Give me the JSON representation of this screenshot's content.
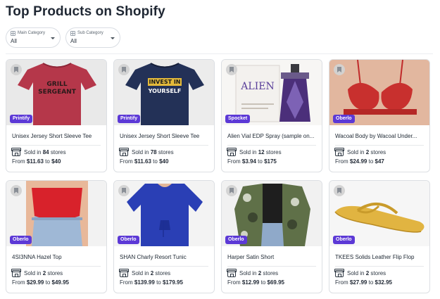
{
  "page": {
    "title": "Top Products on Shopify"
  },
  "filters": [
    {
      "label": "Main Category",
      "value": "All"
    },
    {
      "label": "Sub Category",
      "value": "All"
    }
  ],
  "products": [
    {
      "name": "Unisex Jersey Short Sleeve Tee",
      "source": "Printify",
      "stores_prefix": "Sold in",
      "stores": "84",
      "stores_suffix": "stores",
      "price_prefix": "From",
      "price_from": "$11.63",
      "price_sep": "to",
      "price_to": "$40",
      "image": "red-tshirt"
    },
    {
      "name": "Unisex Jersey Short Sleeve Tee",
      "source": "Printify",
      "stores_prefix": "Sold in",
      "stores": "78",
      "stores_suffix": "stores",
      "price_prefix": "From",
      "price_from": "$11.63",
      "price_sep": "to",
      "price_to": "$40",
      "image": "navy-tshirt"
    },
    {
      "name": "Alien Vial EDP Spray (sample on...",
      "source": "Spocket",
      "stores_prefix": "Sold in",
      "stores": "12",
      "stores_suffix": "stores",
      "price_prefix": "From",
      "price_from": "$3.94",
      "price_sep": "to",
      "price_to": "$175",
      "image": "perfume"
    },
    {
      "name": "Wacoal Body by Wacoal Under...",
      "source": "Oberlo",
      "stores_prefix": "Sold in",
      "stores": "2",
      "stores_suffix": "stores",
      "price_prefix": "From",
      "price_from": "$24.99",
      "price_sep": "to",
      "price_to": "$47",
      "image": "red-bra"
    },
    {
      "name": "4SI3NNA Hazel Top",
      "source": "Oberlo",
      "stores_prefix": "Sold in",
      "stores": "2",
      "stores_suffix": "stores",
      "price_prefix": "From",
      "price_from": "$29.99",
      "price_sep": "to",
      "price_to": "$49.95",
      "image": "red-top"
    },
    {
      "name": "SHAN Charly Resort Tunic",
      "source": "Oberlo",
      "stores_prefix": "Sold in",
      "stores": "2",
      "stores_suffix": "stores",
      "price_prefix": "From",
      "price_from": "$139.99",
      "price_sep": "to",
      "price_to": "$179.95",
      "image": "blue-tunic"
    },
    {
      "name": "Harper Satin Short",
      "source": "Oberlo",
      "stores_prefix": "Sold in",
      "stores": "2",
      "stores_suffix": "stores",
      "price_prefix": "From",
      "price_from": "$12.99",
      "price_sep": "to",
      "price_to": "$69.95",
      "image": "camo-cardigan"
    },
    {
      "name": "TKEES Solids Leather Flip Flop",
      "source": "Oberlo",
      "stores_prefix": "Sold in",
      "stores": "2",
      "stores_suffix": "stores",
      "price_prefix": "From",
      "price_from": "$27.99",
      "price_sep": "to",
      "price_to": "$32.95",
      "image": "flip-flop"
    }
  ],
  "image_text": {
    "shirt1_line1": "GRILL",
    "shirt1_line2": "SERGEANT",
    "shirt2_line1": "INVEST IN",
    "shirt2_line2": "YOURSELF",
    "perfume_brand": "ALIEN"
  },
  "colors": {
    "badge": "#5c39d6",
    "title": "#1f2733",
    "border": "#dcdfe3"
  }
}
